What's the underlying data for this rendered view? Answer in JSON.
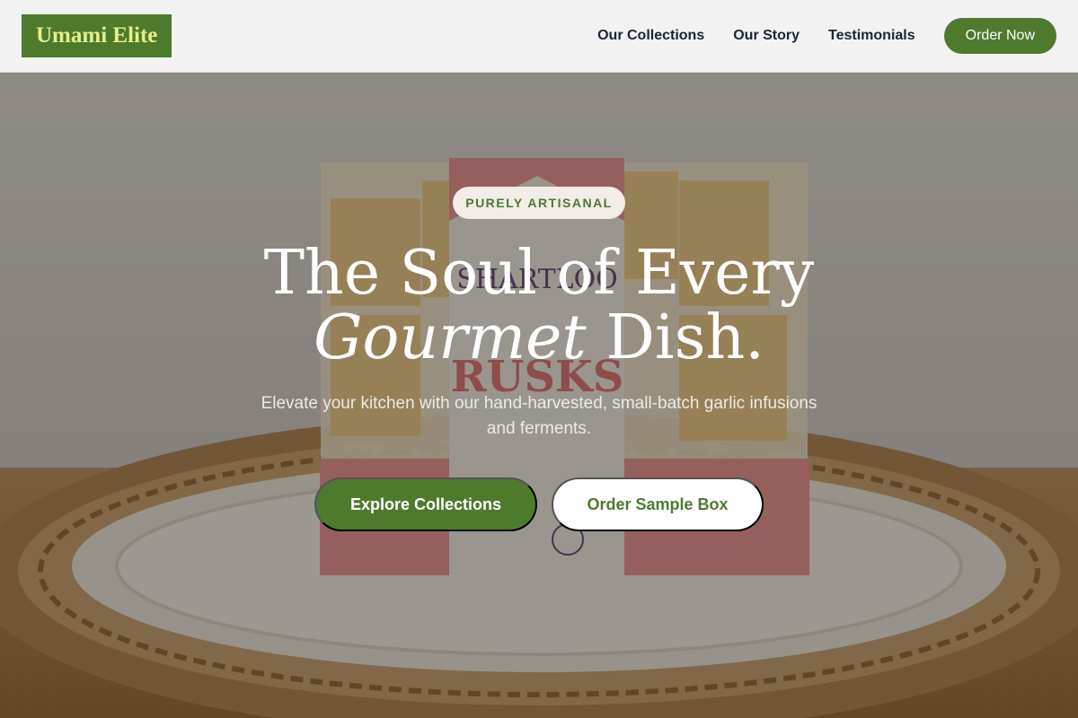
{
  "brand": {
    "logo_text": "Umami Elite",
    "accent_color": "#4e7a2e",
    "logo_text_color": "#e4ef8c"
  },
  "nav": {
    "links": [
      "Our Collections",
      "Our Story",
      "Testimonials"
    ],
    "cta_label": "Order Now"
  },
  "hero": {
    "badge": "PURELY ARTISANAL",
    "headline_line1": "The Soul of Every",
    "headline_italic": "Gourmet",
    "headline_line2_rest": " Dish.",
    "subtext": "Elevate your kitchen with our hand-harvested, small-batch garlic infusions and ferments.",
    "primary_button": "Explore Collections",
    "secondary_button": "Order Sample Box"
  }
}
